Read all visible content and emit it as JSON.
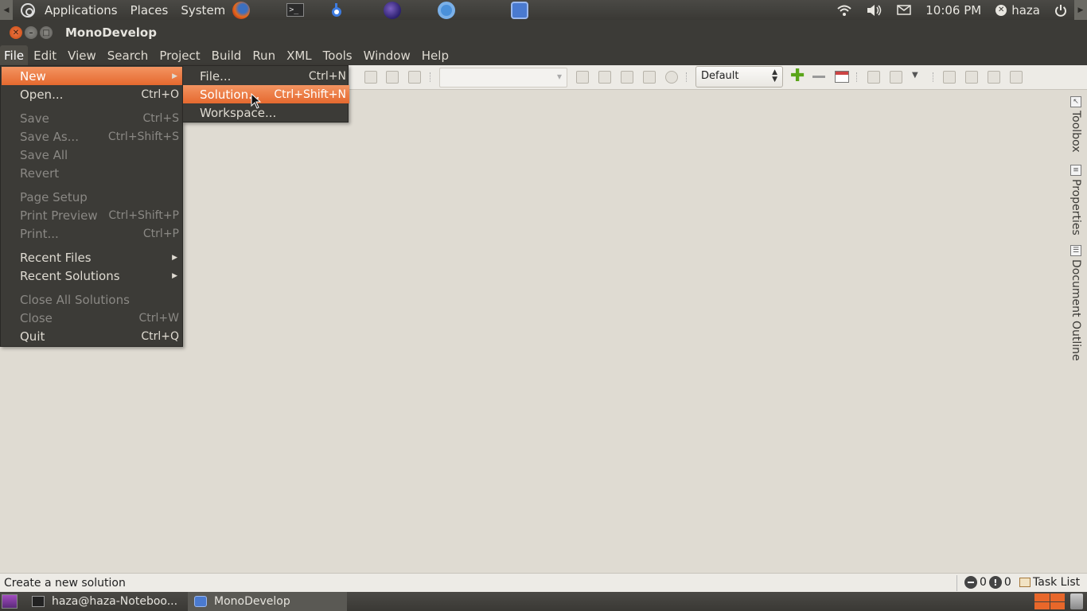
{
  "top_panel": {
    "menus": [
      "Applications",
      "Places",
      "System"
    ],
    "launchers": [
      "firefox-icon",
      "terminal-icon",
      "bluefish-icon",
      "eclipse-icon",
      "chrome-icon",
      "monodevelop-icon"
    ],
    "clock": "10:06 PM",
    "user": "haza",
    "terminal_glyph": ">_"
  },
  "window": {
    "title": "MonoDevelop"
  },
  "menubar": {
    "items": [
      "File",
      "Edit",
      "View",
      "Search",
      "Project",
      "Build",
      "Run",
      "XML",
      "Tools",
      "Window",
      "Help"
    ]
  },
  "toolbar": {
    "configuration": "Default",
    "add_glyph": "✚"
  },
  "file_menu": {
    "items": [
      {
        "label": "New",
        "accel": ""
      },
      {
        "label": "Open...",
        "accel": "Ctrl+O"
      },
      {
        "label": "Save",
        "accel": "Ctrl+S"
      },
      {
        "label": "Save As...",
        "accel": "Ctrl+Shift+S"
      },
      {
        "label": "Save All",
        "accel": ""
      },
      {
        "label": "Revert",
        "accel": ""
      },
      {
        "label": "Page Setup",
        "accel": ""
      },
      {
        "label": "Print Preview",
        "accel": "Ctrl+Shift+P"
      },
      {
        "label": "Print...",
        "accel": "Ctrl+P"
      },
      {
        "label": "Recent Files",
        "accel": ""
      },
      {
        "label": "Recent Solutions",
        "accel": ""
      },
      {
        "label": "Close All Solutions",
        "accel": ""
      },
      {
        "label": "Close",
        "accel": "Ctrl+W"
      },
      {
        "label": "Quit",
        "accel": "Ctrl+Q"
      }
    ]
  },
  "new_submenu": {
    "items": [
      {
        "label": "File...",
        "accel": "Ctrl+N"
      },
      {
        "label": "Solution...",
        "accel": "Ctrl+Shift+N"
      },
      {
        "label": "Workspace...",
        "accel": ""
      }
    ]
  },
  "right_dock": {
    "tabs": [
      "Toolbox",
      "Properties",
      "Document Outline"
    ]
  },
  "statusbar": {
    "message": "Create a new solution",
    "errors": "0",
    "warnings": "0",
    "task_list": "Task List"
  },
  "bottom_panel": {
    "tasks": [
      "haza@haza-Noteboo...",
      "MonoDevelop"
    ]
  },
  "colors": {
    "accent": "#e5692f",
    "panel": "#3c3b37",
    "background": "#dfdbd2"
  }
}
